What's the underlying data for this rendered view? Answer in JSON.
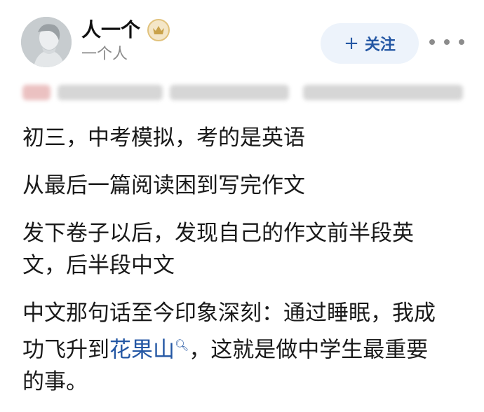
{
  "author": {
    "name": "人一个",
    "subtitle": "一个人",
    "badge_icon": "crown-icon"
  },
  "actions": {
    "follow_label": "关注",
    "follow_icon": "plus-icon",
    "more_icon": "more-dots-icon"
  },
  "post": {
    "p1": "初三，中考模拟，考的是英语",
    "p2": "从最后一篇阅读困到写完作文",
    "p3_line1": "发下卷子以后，发现自己的作文前半段英",
    "p3_line2": "文，后半段中文",
    "p4_line1": "中文那句话至今印象深刻：通过睡眠，我成",
    "p4_line2_pre": "功飞升到",
    "p4_link": "花果山",
    "p4_line2_post": "，这就是做中学生最重要",
    "p4_line3": "的事。"
  },
  "colors": {
    "accent": "#2457a4",
    "follow_bg": "#edf3fb",
    "muted_text": "#8a8a8a"
  }
}
